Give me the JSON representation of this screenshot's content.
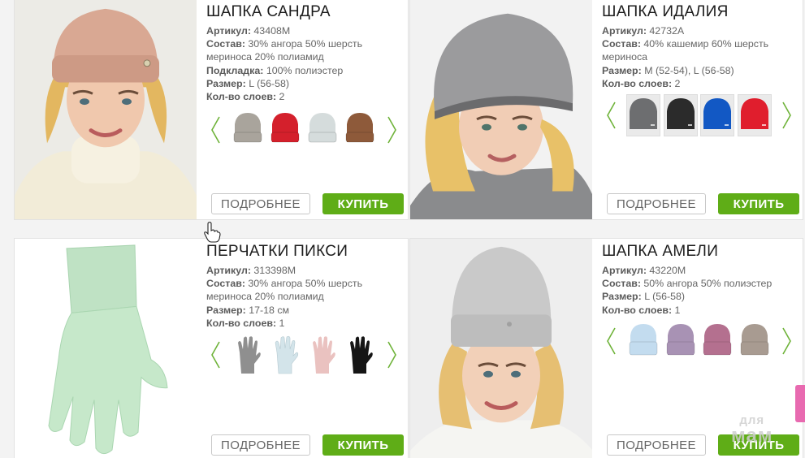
{
  "products": [
    {
      "title": "ШАПКА САНДРА",
      "attrs": [
        {
          "label": "Артикул:",
          "value": " 43408М"
        },
        {
          "label": "Состав:",
          "value": " 30% ангора 50% шерсть мериноса 20% полиамид"
        },
        {
          "label": "Подкладка:",
          "value": " 100% полиэстер"
        },
        {
          "label": "Размер:",
          "value": " L (56-58)"
        },
        {
          "label": "Кол-во слоев:",
          "value": " 2"
        }
      ],
      "swatches": [
        {
          "icon": "hat-swatch-icon",
          "color": "#a9a49c"
        },
        {
          "icon": "hat-swatch-icon",
          "color": "#d4202c"
        },
        {
          "icon": "hat-swatch-icon",
          "color": "#d5dcdc"
        },
        {
          "icon": "hat-swatch-icon",
          "color": "#8e5a3a"
        }
      ],
      "more_label": "ПОДРОБНЕЕ",
      "buy_label": "КУПИТЬ"
    },
    {
      "title": "ШАПКА ИДАЛИЯ",
      "attrs": [
        {
          "label": "Артикул:",
          "value": " 42732А"
        },
        {
          "label": "Состав:",
          "value": " 40% кашемир 60% шерсть мериноса"
        },
        {
          "label": "Размер:",
          "value": " M (52-54), L (56-58)"
        },
        {
          "label": "Кол-во слоев:",
          "value": " 2"
        }
      ],
      "swatches": [
        {
          "icon": "beanie-swatch-icon",
          "color": "#6d6e70"
        },
        {
          "icon": "beanie-swatch-icon",
          "color": "#2b2b2b"
        },
        {
          "icon": "beanie-swatch-icon",
          "color": "#1258c4"
        },
        {
          "icon": "beanie-swatch-icon",
          "color": "#e01e2d"
        }
      ],
      "more_label": "ПОДРОБНЕЕ",
      "buy_label": "КУПИТЬ"
    },
    {
      "title": "ПЕРЧАТКИ ПИКСИ",
      "attrs": [
        {
          "label": "Артикул:",
          "value": " 313398М"
        },
        {
          "label": "Состав:",
          "value": " 30% ангора 50% шерсть мериноса 20% полиамид"
        },
        {
          "label": "Размер:",
          "value": " 17-18 см"
        },
        {
          "label": "Кол-во слоев:",
          "value": " 1"
        }
      ],
      "swatches": [
        {
          "icon": "glove-swatch-icon",
          "color": "#8f8f8f"
        },
        {
          "icon": "glove-swatch-icon",
          "color": "#d3e4ea"
        },
        {
          "icon": "glove-swatch-icon",
          "color": "#eac2c0"
        },
        {
          "icon": "glove-swatch-icon",
          "color": "#151515"
        }
      ],
      "more_label": "ПОДРОБНЕЕ",
      "buy_label": "КУПИТЬ"
    },
    {
      "title": "ШАПКА АМЕЛИ",
      "attrs": [
        {
          "label": "Артикул:",
          "value": " 43220М"
        },
        {
          "label": "Состав:",
          "value": " 50% ангора 50% полиэстер"
        },
        {
          "label": "Размер:",
          "value": " L (56-58)"
        },
        {
          "label": "Кол-во слоев:",
          "value": " 1"
        }
      ],
      "swatches": [
        {
          "icon": "hat-swatch-icon",
          "color": "#c3dcef"
        },
        {
          "icon": "hat-swatch-icon",
          "color": "#a892b4"
        },
        {
          "icon": "hat-swatch-icon",
          "color": "#b4708f"
        },
        {
          "icon": "hat-swatch-icon",
          "color": "#a89b91"
        }
      ],
      "more_label": "ПОДРОБНЕЕ",
      "buy_label": "КУПИТЬ"
    }
  ],
  "watermark": {
    "line1": "для",
    "line2": "мам"
  },
  "colors": {
    "accent_green": "#5fad17",
    "arrow_green": "#6fb33a",
    "side_tab_pink": "#e86ab0"
  }
}
